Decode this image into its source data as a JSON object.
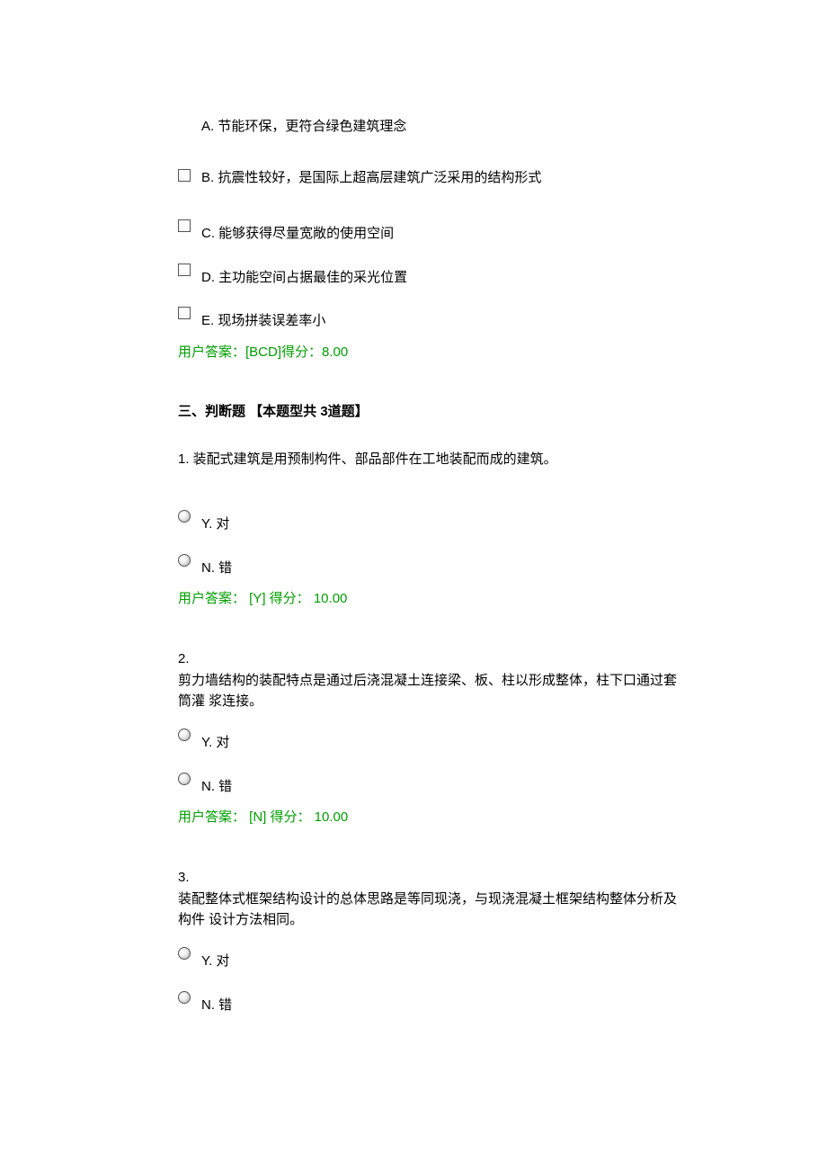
{
  "multi_choice": {
    "options": {
      "A": "A. 节能环保，更符合绿色建筑理念",
      "B": "B. 抗震性较好，是国际上超高层建筑广泛采用的结构形式",
      "C": "C. 能够获得尽量宽敞的使用空间",
      "D": "D. 主功能空间占据最佳的采光位置",
      "E": "E. 现场拼装误差率小"
    },
    "answer": "用户答案：[BCD]得分：8.00"
  },
  "section3": {
    "title": "三、判断题 【本题型共  3道题】",
    "q1": {
      "text": "1.  装配式建筑是用预制构件、部品部件在工地装配而成的建筑。",
      "Y": "Y. 对",
      "N": "N. 错",
      "answer": "用户答案：  [Y] 得分：   10.00"
    },
    "q2": {
      "num": "2.",
      "text": "剪力墙结构的装配特点是通过后浇混凝土连接梁、板、柱以形成整体，柱下口通过套筒灌  浆连接。",
      "Y": "Y. 对",
      "N": "N. 错",
      "answer": "用户答案：  [N] 得分：   10.00"
    },
    "q3": {
      "num": "3.",
      "text": "装配整体式框架结构设计的总体思路是等同现浇，与现浇混凝土框架结构整体分析及构件  设计方法相同。",
      "Y": "Y. 对",
      "N": "N. 错"
    }
  }
}
